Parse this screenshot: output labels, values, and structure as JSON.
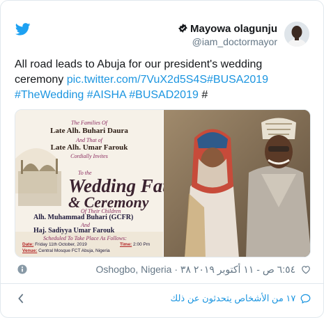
{
  "author": {
    "display_name": "Mayowa olagunju",
    "handle": "@iam_doctormayor"
  },
  "tweet": {
    "text_plain": "All road leads to Abuja for our president's wedding ceremony ",
    "link": "pic.twitter.com/7VuX2d5S4S",
    "hashtags_line1": "#BUSA2019",
    "hashtags_line2": "#TheWedding #AISHA #BUSAD2019",
    "trailing": " #"
  },
  "media": {
    "invitation": {
      "line1": "The Families Of",
      "line2": "Late Alh. Buhari Daura",
      "line3": "And That of",
      "line4": "Late Alh. Umar Farouk",
      "line5": "Cordially Invites",
      "line6": "To the",
      "hero1": "Wedding Fati",
      "hero2": "& Ceremony",
      "line7": "Of Their Children",
      "groom": "Alh. Muhammad Buhari (GCFR)",
      "and": "And",
      "bride": "Haj. Sadiyya Umar Farouk",
      "line8": "Scheduled To Take Place As Follows:",
      "date_label": "Date:",
      "date_value": "Friday 11th October, 2019",
      "time_label": "Time:",
      "time_value": "2:00 Pm",
      "venue_label": "Venue:",
      "venue_value": "Central Mosque FCT Abuja, Nigeria"
    }
  },
  "meta": {
    "likes": "٣٨",
    "timestamp": "٦:٥٤ ص - ١١ أكتوبر ٢٠١٩",
    "separator": "·",
    "location": "Oshogbo, Nigeria"
  },
  "footer": {
    "discussion": "١٧ من الأشخاص يتحدثون عن ذلك"
  },
  "colors": {
    "accent": "#1b95e0",
    "text": "#14171a",
    "muted": "#657786"
  },
  "icons": [
    "twitter-bird-icon",
    "verified-badge-icon",
    "info-icon",
    "heart-icon",
    "chevron-left-icon",
    "speech-bubble-icon"
  ]
}
